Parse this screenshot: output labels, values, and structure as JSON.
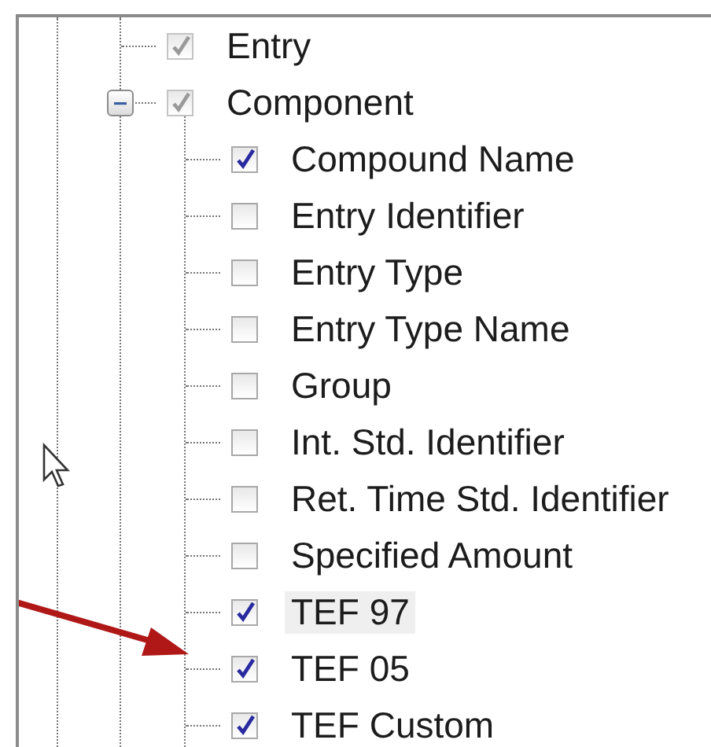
{
  "tree": [
    {
      "label": "Entry",
      "checked": true,
      "disabled": true,
      "hovered": false
    },
    {
      "label": "Component",
      "checked": true,
      "disabled": true,
      "expanded": true,
      "hovered": false,
      "children": [
        {
          "label": "Compound Name",
          "checked": true,
          "disabled": false,
          "hovered": false
        },
        {
          "label": "Entry Identifier",
          "checked": false,
          "disabled": false,
          "hovered": false
        },
        {
          "label": "Entry Type",
          "checked": false,
          "disabled": false,
          "hovered": false
        },
        {
          "label": "Entry Type Name",
          "checked": false,
          "disabled": false,
          "hovered": false
        },
        {
          "label": "Group",
          "checked": false,
          "disabled": false,
          "hovered": false
        },
        {
          "label": "Int. Std. Identifier",
          "checked": false,
          "disabled": false,
          "hovered": false
        },
        {
          "label": "Ret. Time Std. Identifier",
          "checked": false,
          "disabled": false,
          "hovered": false
        },
        {
          "label": "Specified Amount",
          "checked": false,
          "disabled": false,
          "hovered": false
        },
        {
          "label": "TEF 97",
          "checked": true,
          "disabled": false,
          "hovered": true
        },
        {
          "label": "TEF 05",
          "checked": true,
          "disabled": false,
          "hovered": false
        },
        {
          "label": "TEF Custom",
          "checked": true,
          "disabled": false,
          "hovered": false
        }
      ]
    }
  ]
}
